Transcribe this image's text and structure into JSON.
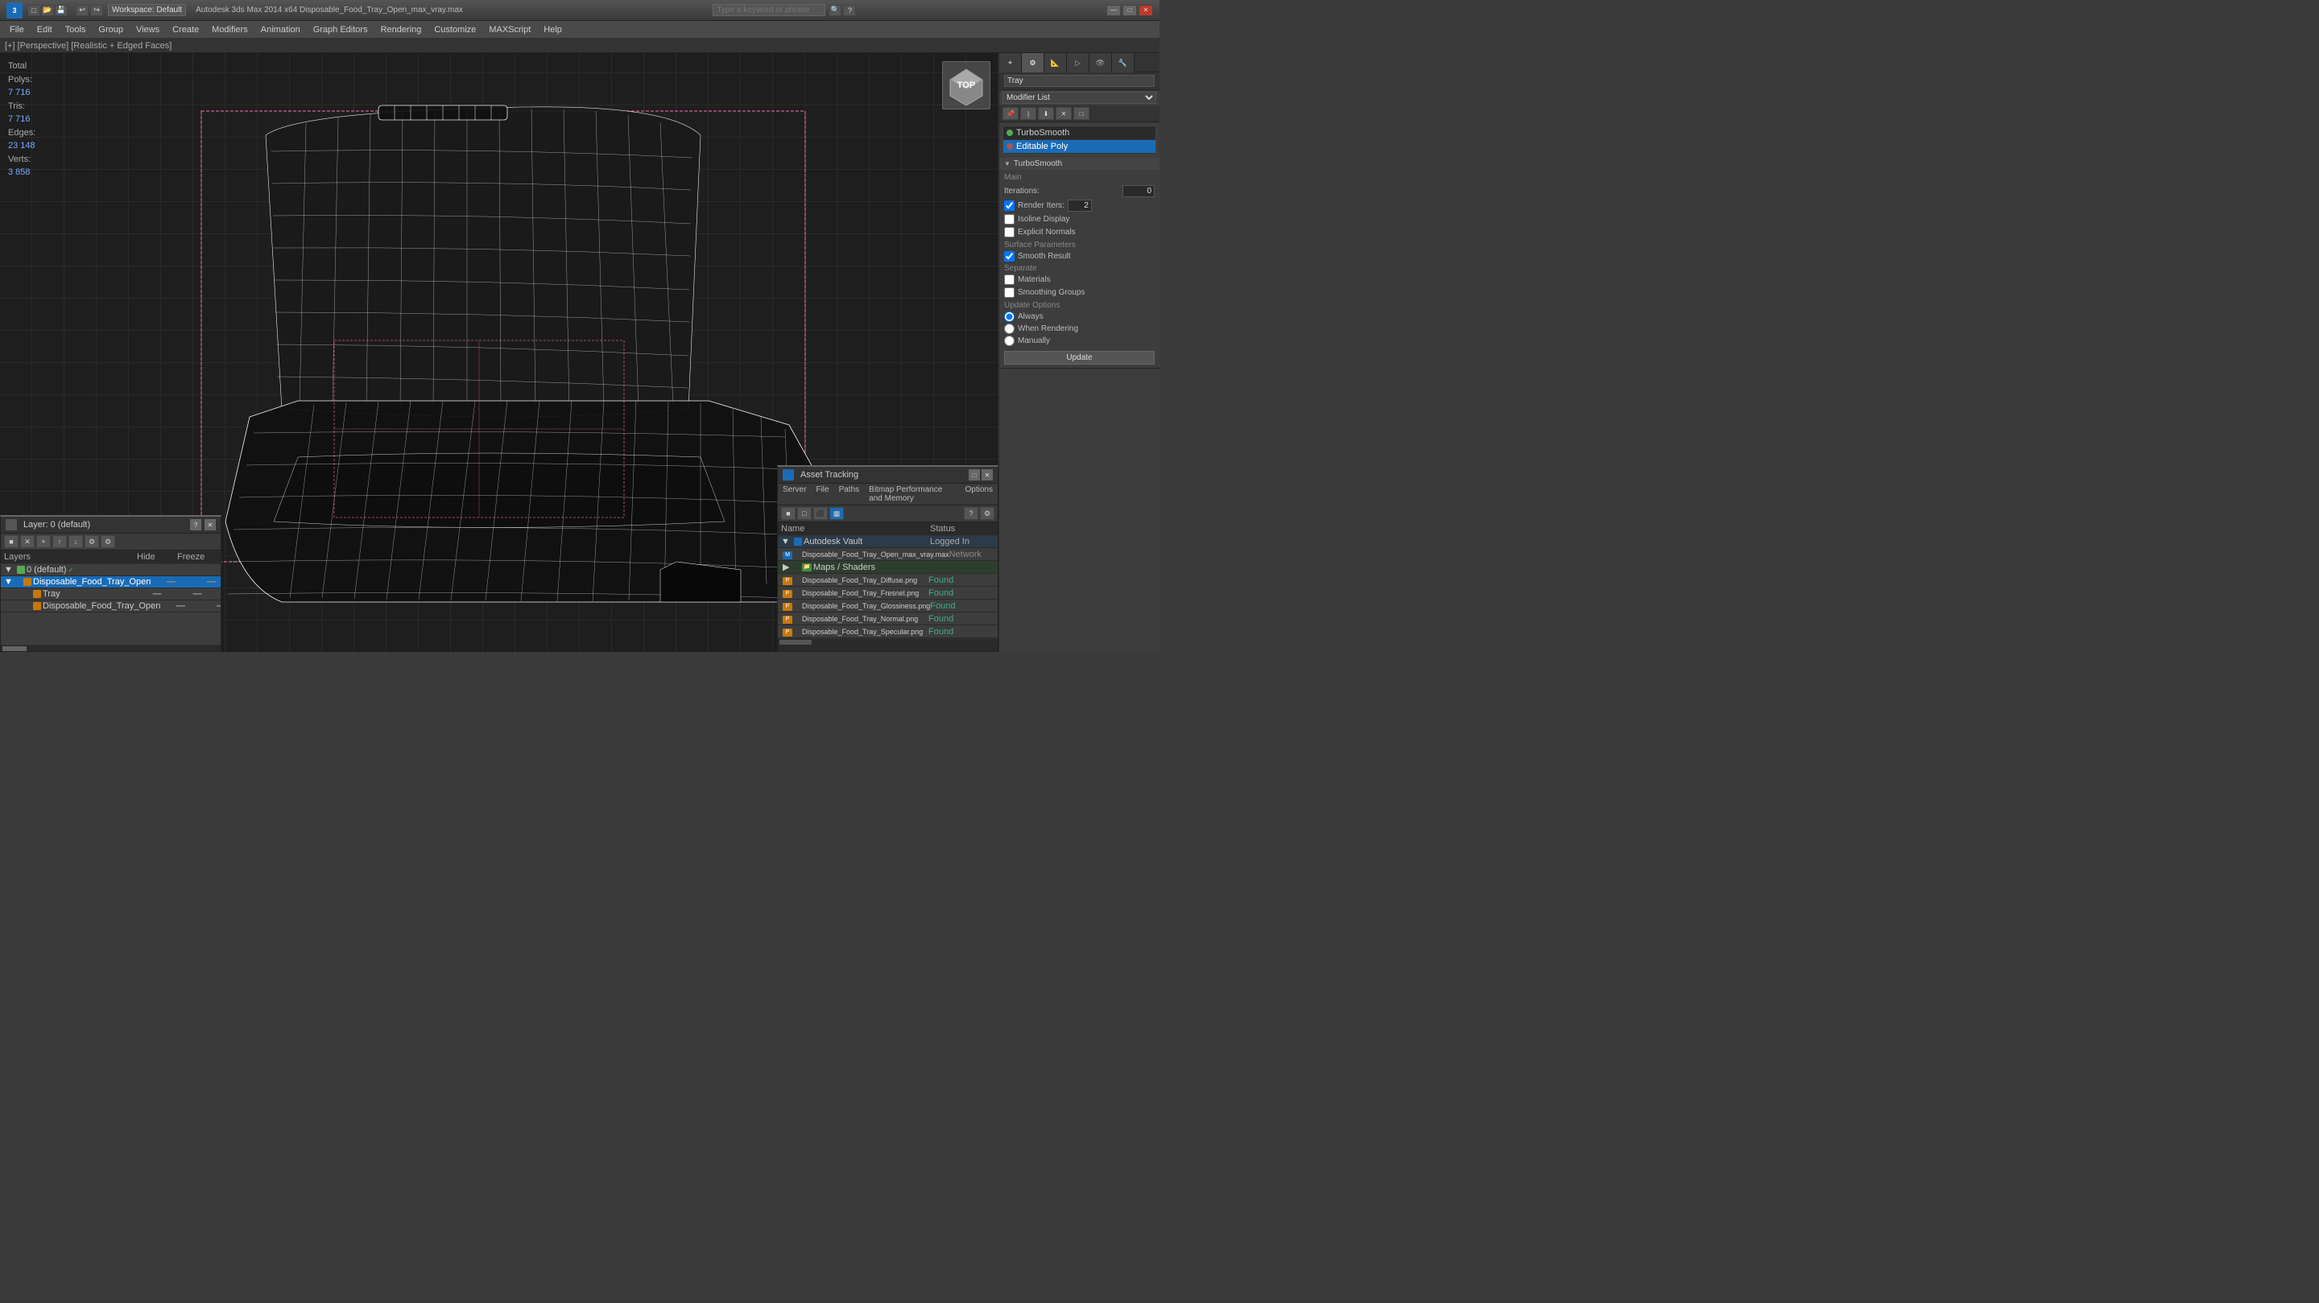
{
  "titlebar": {
    "app_logo": "3",
    "title": "Autodesk 3ds Max  2014 x64    Disposable_Food_Tray_Open_max_vray.max",
    "workspace_label": "Workspace: Default",
    "search_placeholder": "Type a keyword or phrase",
    "undo_btn": "↩",
    "redo_btn": "↪",
    "minimize": "—",
    "maximize": "□",
    "close": "✕"
  },
  "menubar": {
    "items": [
      {
        "label": "File",
        "id": "file"
      },
      {
        "label": "Edit",
        "id": "edit"
      },
      {
        "label": "Tools",
        "id": "tools"
      },
      {
        "label": "Group",
        "id": "group"
      },
      {
        "label": "Views",
        "id": "views"
      },
      {
        "label": "Create",
        "id": "create"
      },
      {
        "label": "Modifiers",
        "id": "modifiers"
      },
      {
        "label": "Animation",
        "id": "animation"
      },
      {
        "label": "Graph Editors",
        "id": "graph-editors"
      },
      {
        "label": "Rendering",
        "id": "rendering"
      },
      {
        "label": "Customize",
        "id": "customize"
      },
      {
        "label": "MAXScript",
        "id": "maxscript"
      },
      {
        "label": "Help",
        "id": "help"
      }
    ]
  },
  "viewport": {
    "label": "[+] [Perspective] [Realistic + Edged Faces]",
    "stats": {
      "polys_label": "Polys:",
      "polys_val": "7 716",
      "tris_label": "Tris:",
      "tris_val": "7 716",
      "edges_label": "Edges:",
      "edges_val": "23 148",
      "verts_label": "Verts:",
      "verts_val": "3 858"
    }
  },
  "right_panel": {
    "object_name": "Tray",
    "modifier_list_label": "Modifier List",
    "modifiers": [
      {
        "name": "TurboSmooth",
        "selected": false
      },
      {
        "name": "Editable Poly",
        "selected": true
      }
    ],
    "turbosmooth": {
      "section_label": "TurboSmooth",
      "main_label": "Main",
      "iterations_label": "Iterations:",
      "iterations_val": "0",
      "render_iters_label": "Render Iters:",
      "render_iters_val": "2",
      "render_iters_checked": true,
      "isoline_display_label": "Isoline Display",
      "explicit_normals_label": "Explicit Normals",
      "surface_params_label": "Surface Parameters",
      "smooth_result_label": "Smooth Result",
      "smooth_result_checked": true,
      "separate_label": "Separate",
      "materials_label": "Materials",
      "smoothing_groups_label": "Smoothing Groups",
      "update_options_label": "Update Options",
      "always_label": "Always",
      "when_rendering_label": "When Rendering",
      "manually_label": "Manually",
      "update_btn_label": "Update"
    },
    "panel_tabs": [
      "◆",
      "⚙",
      "🔧",
      "📋",
      "🔄"
    ]
  },
  "layer_panel": {
    "title": "Layer: 0 (default)",
    "help_btn": "?",
    "close_btn": "✕",
    "label": "Layers",
    "col_hide": "Hide",
    "col_freeze": "Freeze",
    "rows": [
      {
        "level": 0,
        "name": "0 (default)",
        "hide": "",
        "freeze": "",
        "active": true,
        "is_default": true
      },
      {
        "level": 1,
        "name": "Disposable_Food_Tray_Open",
        "hide": "■",
        "freeze": "■",
        "active": true
      },
      {
        "level": 2,
        "name": "Tray",
        "hide": "■",
        "freeze": "■",
        "active": false
      },
      {
        "level": 2,
        "name": "Disposable_Food_Tray_Open",
        "hide": "■",
        "freeze": "■",
        "active": false
      }
    ],
    "toolbar_btns": [
      "■",
      "✕",
      "+",
      "↑",
      "↓",
      "⚙",
      "⚙"
    ]
  },
  "asset_panel": {
    "title": "Asset Tracking",
    "close_btn": "✕",
    "menu": [
      {
        "label": "Server"
      },
      {
        "label": "File"
      },
      {
        "label": "Paths"
      },
      {
        "label": "Bitmap Performance and Memory"
      },
      {
        "label": "Options"
      }
    ],
    "col_name": "Name",
    "col_status": "Status",
    "sections": [
      {
        "type": "vault",
        "name": "Autodesk Vault",
        "status": "Logged In",
        "status_class": "asset-status-logged"
      },
      {
        "type": "file",
        "name": "Disposable_Food_Tray_Open_max_vray.max",
        "status": "Network",
        "status_class": "asset-status-network",
        "icon": "file-max"
      },
      {
        "type": "maps-header",
        "name": "Maps / Shaders",
        "status": "",
        "icon": "folder-green"
      },
      {
        "type": "file",
        "name": "Disposable_Food_Tray_Diffuse.png",
        "status": "Found",
        "status_class": "asset-status-found",
        "icon": "file-img"
      },
      {
        "type": "file",
        "name": "Disposable_Food_Tray_Fresnel.png",
        "status": "Found",
        "status_class": "asset-status-found",
        "icon": "file-img"
      },
      {
        "type": "file",
        "name": "Disposable_Food_Tray_Glossiness.png",
        "status": "Found",
        "status_class": "asset-status-found",
        "icon": "file-img"
      },
      {
        "type": "file",
        "name": "Disposable_Food_Tray_Normal.png",
        "status": "Found",
        "status_class": "asset-status-found",
        "icon": "file-img"
      },
      {
        "type": "file",
        "name": "Disposable_Food_Tray_Specular.png",
        "status": "Found",
        "status_class": "asset-status-found",
        "icon": "file-img"
      }
    ]
  }
}
